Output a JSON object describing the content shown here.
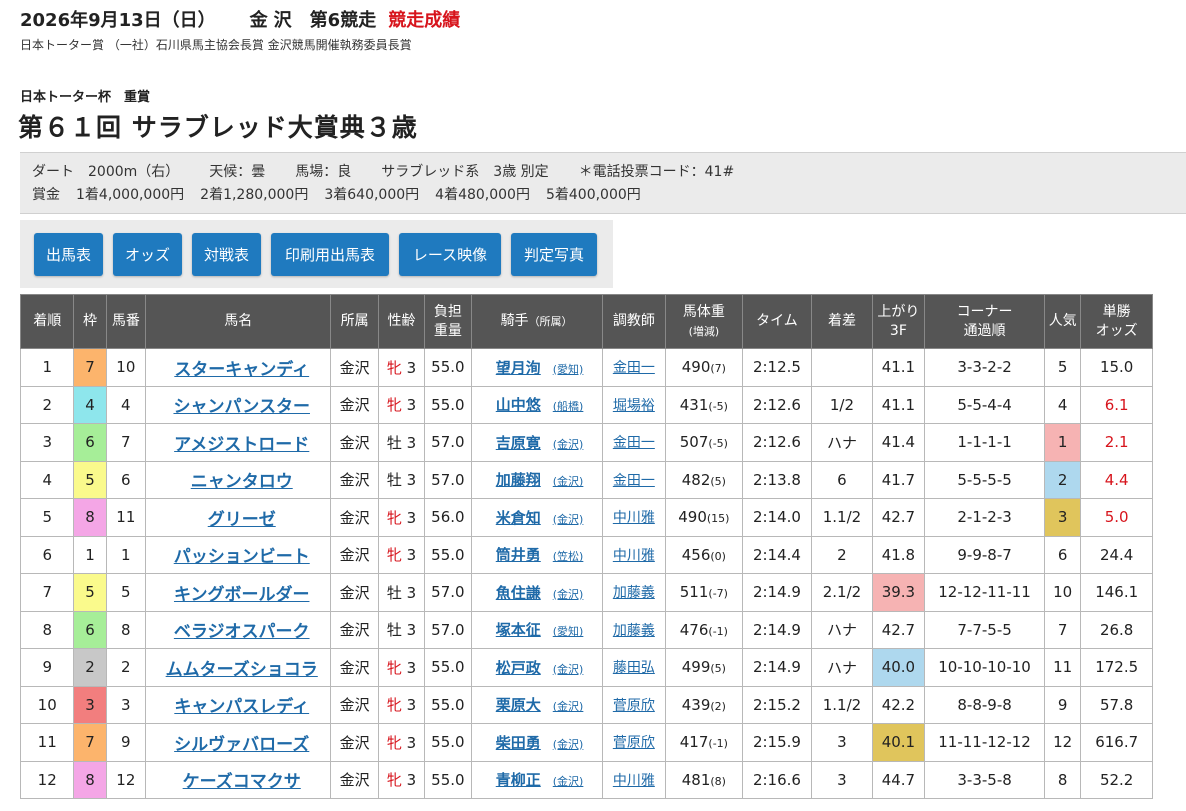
{
  "header": {
    "date": "2026年9月13日（日）",
    "venue": "金沢",
    "race_no": "第6競走",
    "result_label": "競走成績",
    "sponsors": "日本トーター賞 （一社）石川県馬主協会長賞 金沢競馬開催執務委員長賞",
    "race_sub": "日本トーター杯　重賞",
    "race_name": "第６１回 サラブレッド大賞典３歳"
  },
  "info": {
    "course": "ダート　2000m（右）",
    "weather": "天候：曇",
    "track": "馬場：良",
    "conditions": "サラブレッド系　3歳 別定",
    "phone_code": "＊電話投票コード：41#",
    "prize_label": "賞金",
    "prizes": [
      "1着4,000,000円",
      "2着1,280,000円",
      "3着640,000円",
      "4着480,000円",
      "5着400,000円"
    ]
  },
  "buttons": [
    "出馬表",
    "オッズ",
    "対戦表",
    "印刷用出馬表",
    "レース映像",
    "判定写真"
  ],
  "table": {
    "headers": {
      "rank": "着順",
      "waku": "枠",
      "umaban": "馬番",
      "horse": "馬名",
      "affiliation": "所属",
      "sexage": "性齢",
      "burden_1": "負担",
      "burden_2": "重量",
      "jockey": "騎手",
      "jockey_small": "（所属）",
      "trainer": "調教師",
      "bodyweight_1": "馬体重",
      "bodyweight_2": "(増減)",
      "time": "タイム",
      "margin": "着差",
      "last3f_1": "上がり",
      "last3f_2": "3F",
      "corner_1": "コーナー",
      "corner_2": "通過順",
      "popularity": "人気",
      "odds_1": "単勝",
      "odds_2": "オッズ"
    },
    "rows": [
      {
        "rank": "1",
        "waku": "7",
        "umaban": "10",
        "horse": "スターキャンディ",
        "aff": "金沢",
        "sex": "牝",
        "age": "3",
        "burden": "55.0",
        "jockey": "望月洵",
        "jaff": "(愛知)",
        "trainer": "金田一",
        "bw": "490",
        "bwd": "(7)",
        "time": "2:12.5",
        "margin": "",
        "last3f": "41.1",
        "corner": "3-3-2-2",
        "pop": "5",
        "odds": "15.0"
      },
      {
        "rank": "2",
        "waku": "4",
        "umaban": "4",
        "horse": "シャンパンスター",
        "aff": "金沢",
        "sex": "牝",
        "age": "3",
        "burden": "55.0",
        "jockey": "山中悠",
        "jaff": "(船橋)",
        "trainer": "堀場裕",
        "bw": "431",
        "bwd": "(-5)",
        "time": "2:12.6",
        "margin": "1/2",
        "last3f": "41.1",
        "corner": "5-5-4-4",
        "pop": "4",
        "odds": "6.1"
      },
      {
        "rank": "3",
        "waku": "6",
        "umaban": "7",
        "horse": "アメジストロード",
        "aff": "金沢",
        "sex": "牡",
        "age": "3",
        "burden": "57.0",
        "jockey": "吉原寛",
        "jaff": "(金沢)",
        "trainer": "金田一",
        "bw": "507",
        "bwd": "(-5)",
        "time": "2:12.6",
        "margin": "ハナ",
        "last3f": "41.4",
        "corner": "1-1-1-1",
        "pop": "1",
        "odds": "2.1"
      },
      {
        "rank": "4",
        "waku": "5",
        "umaban": "6",
        "horse": "ニャンタロウ",
        "aff": "金沢",
        "sex": "牡",
        "age": "3",
        "burden": "57.0",
        "jockey": "加藤翔",
        "jaff": "(金沢)",
        "trainer": "金田一",
        "bw": "482",
        "bwd": "(5)",
        "time": "2:13.8",
        "margin": "6",
        "last3f": "41.7",
        "corner": "5-5-5-5",
        "pop": "2",
        "odds": "4.4"
      },
      {
        "rank": "5",
        "waku": "8",
        "umaban": "11",
        "horse": "グリーゼ",
        "aff": "金沢",
        "sex": "牝",
        "age": "3",
        "burden": "56.0",
        "jockey": "米倉知",
        "jaff": "(金沢)",
        "trainer": "中川雅",
        "bw": "490",
        "bwd": "(15)",
        "time": "2:14.0",
        "margin": "1.1/2",
        "last3f": "42.7",
        "corner": "2-1-2-3",
        "pop": "3",
        "odds": "5.0"
      },
      {
        "rank": "6",
        "waku": "1",
        "umaban": "1",
        "horse": "パッションビート",
        "aff": "金沢",
        "sex": "牝",
        "age": "3",
        "burden": "55.0",
        "jockey": "筒井勇",
        "jaff": "(笠松)",
        "trainer": "中川雅",
        "bw": "456",
        "bwd": "(0)",
        "time": "2:14.4",
        "margin": "2",
        "last3f": "41.8",
        "corner": "9-9-8-7",
        "pop": "6",
        "odds": "24.4"
      },
      {
        "rank": "7",
        "waku": "5",
        "umaban": "5",
        "horse": "キングボールダー",
        "aff": "金沢",
        "sex": "牡",
        "age": "3",
        "burden": "57.0",
        "jockey": "魚住謙",
        "jaff": "(金沢)",
        "trainer": "加藤義",
        "bw": "511",
        "bwd": "(-7)",
        "time": "2:14.9",
        "margin": "2.1/2",
        "last3f": "39.3",
        "corner": "12-12-11-11",
        "pop": "10",
        "odds": "146.1"
      },
      {
        "rank": "8",
        "waku": "6",
        "umaban": "8",
        "horse": "ベラジオスパーク",
        "aff": "金沢",
        "sex": "牡",
        "age": "3",
        "burden": "57.0",
        "jockey": "塚本征",
        "jaff": "(愛知)",
        "trainer": "加藤義",
        "bw": "476",
        "bwd": "(-1)",
        "time": "2:14.9",
        "margin": "ハナ",
        "last3f": "42.7",
        "corner": "7-7-5-5",
        "pop": "7",
        "odds": "26.8"
      },
      {
        "rank": "9",
        "waku": "2",
        "umaban": "2",
        "horse": "ムムターズショコラ",
        "aff": "金沢",
        "sex": "牝",
        "age": "3",
        "burden": "55.0",
        "jockey": "松戸政",
        "jaff": "(金沢)",
        "trainer": "藤田弘",
        "bw": "499",
        "bwd": "(5)",
        "time": "2:14.9",
        "margin": "ハナ",
        "last3f": "40.0",
        "corner": "10-10-10-10",
        "pop": "11",
        "odds": "172.5"
      },
      {
        "rank": "10",
        "waku": "3",
        "umaban": "3",
        "horse": "キャンパスレディ",
        "aff": "金沢",
        "sex": "牝",
        "age": "3",
        "burden": "55.0",
        "jockey": "栗原大",
        "jaff": "(金沢)",
        "trainer": "菅原欣",
        "bw": "439",
        "bwd": "(2)",
        "time": "2:15.2",
        "margin": "1.1/2",
        "last3f": "42.2",
        "corner": "8-8-9-8",
        "pop": "9",
        "odds": "57.8"
      },
      {
        "rank": "11",
        "waku": "7",
        "umaban": "9",
        "horse": "シルヴァバローズ",
        "aff": "金沢",
        "sex": "牝",
        "age": "3",
        "burden": "55.0",
        "jockey": "柴田勇",
        "jaff": "(金沢)",
        "trainer": "菅原欣",
        "bw": "417",
        "bwd": "(-1)",
        "time": "2:15.9",
        "margin": "3",
        "last3f": "40.1",
        "corner": "11-11-12-12",
        "pop": "12",
        "odds": "616.7"
      },
      {
        "rank": "12",
        "waku": "8",
        "umaban": "12",
        "horse": "ケーズコマクサ",
        "aff": "金沢",
        "sex": "牝",
        "age": "3",
        "burden": "55.0",
        "jockey": "青柳正",
        "jaff": "(金沢)",
        "trainer": "中川雅",
        "bw": "481",
        "bwd": "(8)",
        "time": "2:16.6",
        "margin": "3",
        "last3f": "44.7",
        "corner": "3-3-5-8",
        "pop": "8",
        "odds": "52.2"
      }
    ]
  },
  "highlights": {
    "pop_colors": {
      "1": "#f6b3b3",
      "2": "#aed8ee",
      "3": "#e0c55c"
    },
    "last3f_ranks": {
      "39.3": "#f6b3b3",
      "40.0": "#aed8ee",
      "40.1": "#e0c55c"
    },
    "red_odds_popularity_max": 4
  }
}
